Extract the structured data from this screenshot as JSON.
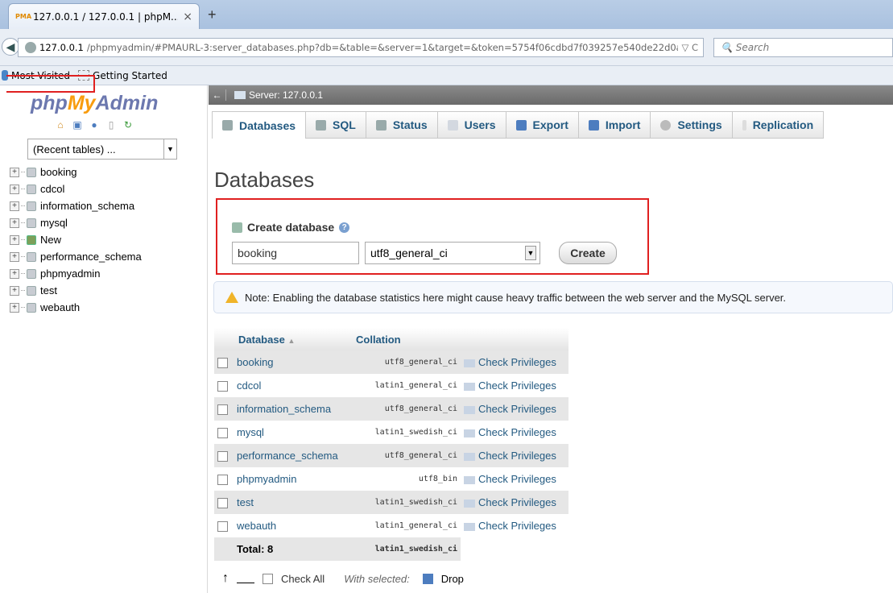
{
  "browser": {
    "tab_title": "127.0.0.1 / 127.0.0.1 | phpM...",
    "tab_close": "×",
    "new_tab": "+",
    "favicon_text": "PMA",
    "url_host": "127.0.0.1",
    "url_rest": "/phpmyadmin/#PMAURL-3:server_databases.php?db=&table=&server=1&target=&token=5754f06cdbd7f039257e540de22d0a",
    "url_controls": "▽ C",
    "search_placeholder": "Search",
    "bookmarks": [
      "Most Visited",
      "Getting Started"
    ]
  },
  "nav": {
    "logo_php": "php",
    "logo_my": "My",
    "logo_admin": "Admin",
    "recent_tables": "(Recent tables) ...",
    "databases": [
      {
        "name": "booking",
        "icon": "db-icon"
      },
      {
        "name": "cdcol",
        "icon": "db-icon"
      },
      {
        "name": "information_schema",
        "icon": "db-icon"
      },
      {
        "name": "mysql",
        "icon": "db-icon"
      },
      {
        "name": "New",
        "icon": "new-db-icon"
      },
      {
        "name": "performance_schema",
        "icon": "db-icon"
      },
      {
        "name": "phpmyadmin",
        "icon": "db-icon"
      },
      {
        "name": "test",
        "icon": "db-icon"
      },
      {
        "name": "webauth",
        "icon": "db-icon"
      }
    ]
  },
  "server_bar": {
    "label": "Server: 127.0.0.1",
    "collapse": "←"
  },
  "menu": {
    "tabs": [
      "Databases",
      "SQL",
      "Status",
      "Users",
      "Export",
      "Import",
      "Settings",
      "Replication"
    ]
  },
  "page": {
    "title": "Databases",
    "create": {
      "legend": "Create database",
      "help": "?",
      "name_value": "booking",
      "collation_value": "utf8_general_ci",
      "button": "Create"
    },
    "note": "Note: Enabling the database statistics here might cause heavy traffic between the web server and the MySQL server."
  },
  "table": {
    "headers": {
      "database": "Database",
      "sort": "▲",
      "collation": "Collation"
    },
    "rows": [
      {
        "name": "booking",
        "collation": "utf8_general_ci",
        "action": "Check Privileges"
      },
      {
        "name": "cdcol",
        "collation": "latin1_general_ci",
        "action": "Check Privileges"
      },
      {
        "name": "information_schema",
        "collation": "utf8_general_ci",
        "action": "Check Privileges"
      },
      {
        "name": "mysql",
        "collation": "latin1_swedish_ci",
        "action": "Check Privileges"
      },
      {
        "name": "performance_schema",
        "collation": "utf8_general_ci",
        "action": "Check Privileges"
      },
      {
        "name": "phpmyadmin",
        "collation": "utf8_bin",
        "action": "Check Privileges"
      },
      {
        "name": "test",
        "collation": "latin1_swedish_ci",
        "action": "Check Privileges"
      },
      {
        "name": "webauth",
        "collation": "latin1_general_ci",
        "action": "Check Privileges"
      }
    ],
    "total_label": "Total: 8",
    "total_collation": "latin1_swedish_ci"
  },
  "footer": {
    "check_all": "Check All",
    "with_selected": "With selected:",
    "drop": "Drop"
  }
}
